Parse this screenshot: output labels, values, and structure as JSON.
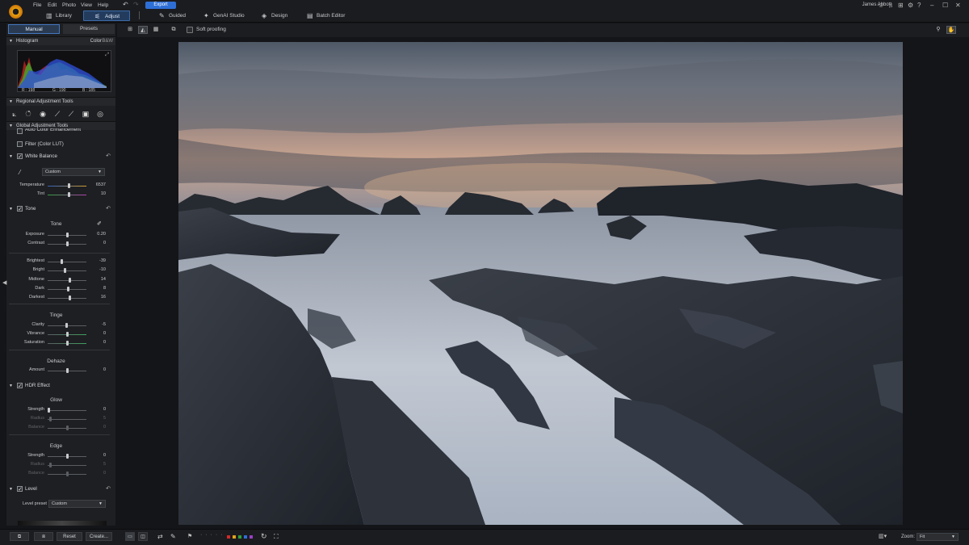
{
  "menu": [
    "File",
    "Edit",
    "Photo",
    "View",
    "Help"
  ],
  "export_label": "Export",
  "nav_tabs": [
    {
      "label": "Library",
      "icon": "library-icon"
    },
    {
      "label": "Adjust",
      "icon": "adjust-icon"
    },
    {
      "label": "Guided",
      "icon": "guided-icon"
    },
    {
      "label": "GenAI Studio",
      "icon": "genai-icon"
    },
    {
      "label": "Design",
      "icon": "design-icon"
    },
    {
      "label": "Batch Editor",
      "icon": "batch-editor-icon"
    }
  ],
  "user_name": "James Abbott",
  "left": {
    "mode_tabs": [
      "Manual",
      "Presets"
    ],
    "histogram": {
      "title": "Histogram",
      "mode_color": "Color",
      "mode_bw": "B&W",
      "r": "R : 198",
      "g": "G : 190",
      "b": "B : 185"
    },
    "regional_title": "Regional Adjustment Tools",
    "global_title": "Global Adjustment Tools",
    "auto_color": "Auto Color Enhancement",
    "filter_lut": "Filter (Color LUT)",
    "white_balance": {
      "title": "White Balance",
      "preset": "Custom",
      "sliders": [
        {
          "label": "Temperature",
          "value": "6537",
          "pos": 0.55
        },
        {
          "label": "Tint",
          "value": "10",
          "pos": 0.55
        }
      ]
    },
    "tone": {
      "title": "Tone",
      "cat_tone": "Tone",
      "tone_sliders": [
        {
          "label": "Exposure",
          "value": "0.20",
          "pos": 0.52
        },
        {
          "label": "Contrast",
          "value": "0",
          "pos": 0.5
        }
      ],
      "range_sliders": [
        {
          "label": "Brightest",
          "value": "-39",
          "pos": 0.35
        },
        {
          "label": "Bright",
          "value": "-10",
          "pos": 0.45
        },
        {
          "label": "Midtone",
          "value": "14",
          "pos": 0.57
        },
        {
          "label": "Dark",
          "value": "8",
          "pos": 0.54
        },
        {
          "label": "Darkest",
          "value": "16",
          "pos": 0.58
        }
      ],
      "cat_tinge": "Tinge",
      "tinge_sliders": [
        {
          "label": "Clarity",
          "value": "-5",
          "pos": 0.48
        },
        {
          "label": "Vibrance",
          "value": "0",
          "pos": 0.5
        },
        {
          "label": "Saturation",
          "value": "0",
          "pos": 0.5
        }
      ],
      "cat_dehaze": "Dehaze",
      "dehaze_sliders": [
        {
          "label": "Amount",
          "value": "0",
          "pos": 0.5
        }
      ]
    },
    "hdr": {
      "title": "HDR Effect",
      "cat_glow": "Glow",
      "glow": [
        {
          "label": "Strength",
          "value": "0",
          "pos": 0.0
        },
        {
          "label": "Radius",
          "value": "5",
          "pos": 0.05
        },
        {
          "label": "Balance",
          "value": "0",
          "pos": 0.5
        }
      ],
      "cat_edge": "Edge",
      "edge": [
        {
          "label": "Strength",
          "value": "0",
          "pos": 0.5
        },
        {
          "label": "Radius",
          "value": "5",
          "pos": 0.05
        },
        {
          "label": "Balance",
          "value": "0",
          "pos": 0.5
        }
      ]
    },
    "level": {
      "title": "Level",
      "preset_label": "Level preset",
      "preset": "Custom"
    },
    "reset_label": "Reset",
    "create_label": "Create..."
  },
  "view": {
    "soft_proofing": "Soft proofing"
  },
  "bottom": {
    "zoom_label": "Zoom:",
    "zoom_value": "Fit",
    "colors": [
      "#d12a2a",
      "#e0a41c",
      "#2f9e3a",
      "#2f6fd6",
      "#9a3fc7"
    ]
  }
}
